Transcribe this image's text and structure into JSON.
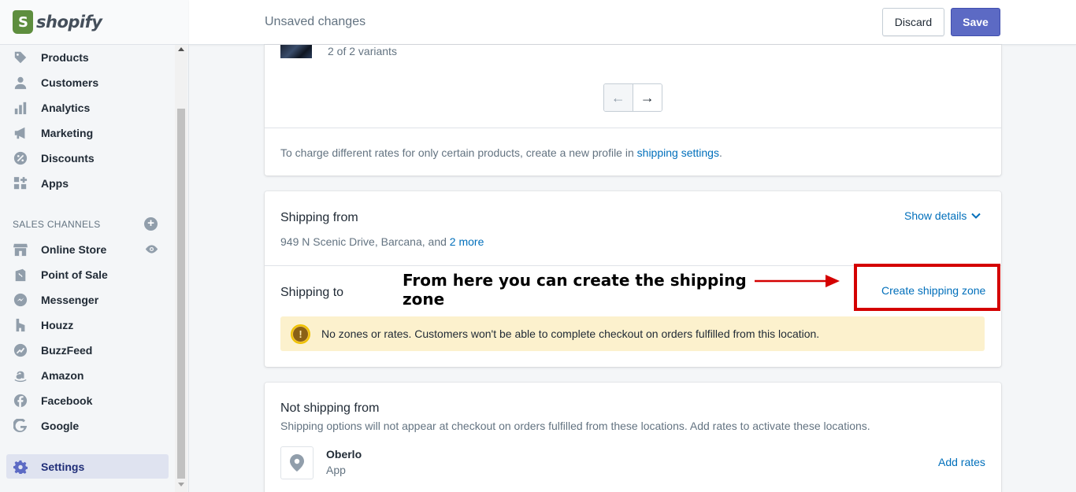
{
  "brand": {
    "logo_text": "shopify",
    "logo_color": "#5e8e3e"
  },
  "sidebar": {
    "items": [
      {
        "label": "Products",
        "icon": "tag-icon"
      },
      {
        "label": "Customers",
        "icon": "person-icon"
      },
      {
        "label": "Analytics",
        "icon": "bar-chart-icon"
      },
      {
        "label": "Marketing",
        "icon": "megaphone-icon"
      },
      {
        "label": "Discounts",
        "icon": "discount-badge-icon"
      },
      {
        "label": "Apps",
        "icon": "apps-grid-icon"
      }
    ],
    "channels_heading": "SALES CHANNELS",
    "channels": [
      {
        "label": "Online Store",
        "icon": "storefront-icon"
      },
      {
        "label": "Point of Sale",
        "icon": "shopping-bag-icon"
      },
      {
        "label": "Messenger",
        "icon": "messenger-icon"
      },
      {
        "label": "Houzz",
        "icon": "houzz-icon"
      },
      {
        "label": "BuzzFeed",
        "icon": "buzzfeed-icon"
      },
      {
        "label": "Amazon",
        "icon": "amazon-icon"
      },
      {
        "label": "Facebook",
        "icon": "facebook-icon"
      },
      {
        "label": "Google",
        "icon": "google-icon"
      }
    ],
    "settings_label": "Settings"
  },
  "topbar": {
    "title": "Unsaved changes",
    "discard_label": "Discard",
    "save_label": "Save",
    "save_color": "#5c6ac4"
  },
  "products_card": {
    "variants_text": "2 of 2 variants",
    "prev_arrow": "←",
    "next_arrow": "→",
    "note_text": "To charge different rates for only certain products, create a new profile in ",
    "note_link": "shipping settings",
    "note_end": "."
  },
  "shipping_card": {
    "from_title": "Shipping from",
    "address": "949 N Scenic Drive, Barcana, and ",
    "more_link": "2 more",
    "show_details": "Show details",
    "to_title": "Shipping to",
    "create_zone": "Create shipping zone",
    "warning_glyph": "!",
    "warning_text": "No zones or rates. Customers won't be able to complete checkout on orders fulfilled from this location."
  },
  "not_shipping_card": {
    "title": "Not shipping from",
    "subtitle": "Shipping options will not appear at checkout on orders fulfilled from these locations. Add rates to activate these locations.",
    "location_name": "Oberlo",
    "location_type": "App",
    "add_rates": "Add rates"
  },
  "annotation": {
    "text": "From here you can create the shipping zone",
    "color": "#d40000"
  }
}
